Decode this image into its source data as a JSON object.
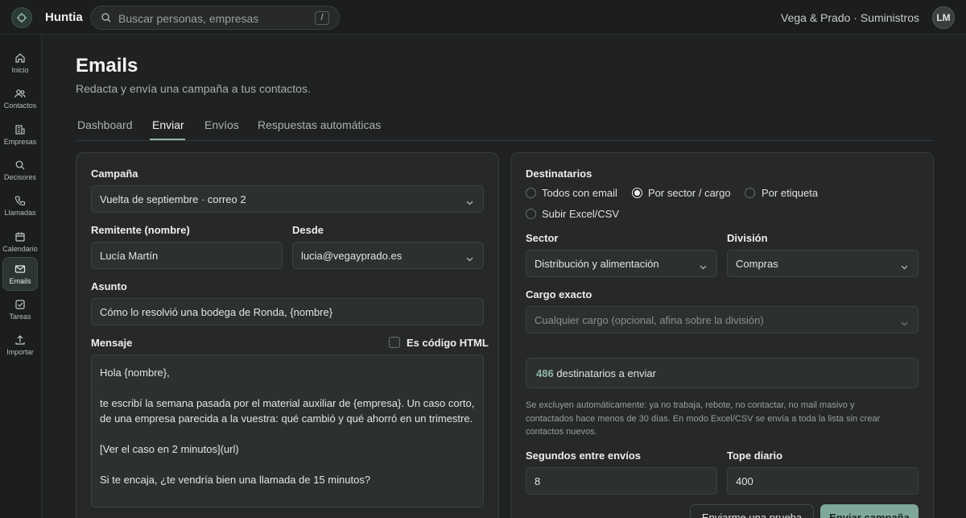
{
  "app": {
    "name": "Huntia",
    "org": "Vega & Prado · Suministros",
    "avatar_initials": "LM"
  },
  "search": {
    "placeholder": "Buscar personas, empresas",
    "shortcut": "/"
  },
  "sidebar": {
    "items": [
      {
        "label": "Inicio",
        "icon": "home-icon"
      },
      {
        "label": "Contactos",
        "icon": "users-icon"
      },
      {
        "label": "Empresas",
        "icon": "building-icon"
      },
      {
        "label": "Decisores",
        "icon": "search-icon"
      },
      {
        "label": "Llamadas",
        "icon": "phone-icon"
      },
      {
        "label": "Calendario",
        "icon": "calendar-icon"
      },
      {
        "label": "Emails",
        "icon": "mail-icon",
        "active": true
      },
      {
        "label": "Tareas",
        "icon": "checkbox-icon"
      },
      {
        "label": "Importar",
        "icon": "upload-icon"
      }
    ]
  },
  "header": {
    "title": "Emails",
    "subtitle": "Redacta y envía una campaña a tus contactos."
  },
  "tabs": [
    {
      "label": "Dashboard"
    },
    {
      "label": "Enviar",
      "active": true
    },
    {
      "label": "Envíos"
    },
    {
      "label": "Respuestas automáticas"
    }
  ],
  "compose": {
    "campaign_label": "Campaña",
    "campaign_value": "Vuelta de septiembre · correo 2",
    "sender_label": "Remitente (nombre)",
    "sender_value": "Lucía Martín",
    "from_label": "Desde",
    "from_value": "lucia@vegayprado.es",
    "subject_label": "Asunto",
    "subject_value": "Cómo lo resolvió una bodega de Ronda, {nombre}",
    "message_label": "Mensaje",
    "html_checkbox_label": "Es código HTML",
    "message_lines": [
      "Hola {nombre},",
      "te escribí la semana pasada por el material auxiliar de {empresa}. Un caso corto, de una empresa parecida a la vuestra: qué cambió y qué ahorró en un trimestre.",
      "[Ver el caso en 2 minutos](url)",
      "Si te encaja, ¿te vendría bien una llamada de 15 minutos?"
    ]
  },
  "recipients": {
    "label": "Destinatarios",
    "options": [
      {
        "label": "Todos con email",
        "selected": false
      },
      {
        "label": "Por sector / cargo",
        "selected": true
      },
      {
        "label": "Por etiqueta",
        "selected": false
      },
      {
        "label": "Subir Excel/CSV",
        "selected": false
      }
    ],
    "sector_label": "Sector",
    "sector_value": "Distribución y alimentación",
    "division_label": "División",
    "division_value": "Compras",
    "cargo_label": "Cargo exacto",
    "cargo_placeholder": "Cualquier cargo (opcional, afina sobre la división)",
    "count": "486",
    "count_suffix": "destinatarios a enviar",
    "note": "Se excluyen automáticamente: ya no trabaja, rebote, no contactar, no mail masivo y contactados hace menos de 30 días. En modo Excel/CSV se envía a toda la lista sin crear contactos nuevos.",
    "interval_label": "Segundos entre envíos",
    "interval_value": "8",
    "daily_cap_label": "Tope diario",
    "daily_cap_value": "400",
    "test_button": "Enviarme una prueba",
    "send_button": "Enviar campaña"
  },
  "colors": {
    "accent": "#8fb6a6",
    "button_primary": "#7fa898",
    "background": "#1f2122",
    "panel": "#262829"
  }
}
